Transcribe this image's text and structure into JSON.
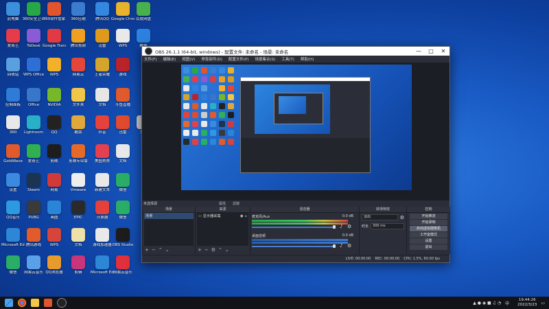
{
  "desktop": {
    "icons": [
      {
        "label": "此电脑",
        "color": "#3b8fdb"
      },
      {
        "label": "360安全卫士",
        "color": "#28a745"
      },
      {
        "label": "360软件管家",
        "color": "#e0542e"
      },
      {
        "label": "360压缩",
        "color": "#3a7cd0"
      },
      {
        "label": "腾讯QQ",
        "color": "#3488e0"
      },
      {
        "label": "Google Chrome",
        "color": "#e8b22d"
      },
      {
        "label": "百度网盘",
        "color": "#48b14d"
      },
      {
        "label": "爱奇艺",
        "color": "#e53b4b"
      },
      {
        "label": "ToDesk",
        "color": "#8a5bd6"
      },
      {
        "label": "Google Translate",
        "color": "#e23a43"
      },
      {
        "label": "腾讯视频",
        "color": "#f0a020"
      },
      {
        "label": "迅雷",
        "color": "#e09a1b"
      },
      {
        "label": "WPS",
        "color": "#e9e9e9"
      },
      {
        "label": "酷狗",
        "color": "#2c82e0"
      },
      {
        "label": "回收站",
        "color": "#5aa0e0"
      },
      {
        "label": "WPS Office",
        "color": "#2d6fd6"
      },
      {
        "label": "WPS",
        "color": "#f3b02b"
      },
      {
        "label": "网易云",
        "color": "#e5463a"
      },
      {
        "label": "王者荣耀",
        "color": "#d4a52c"
      },
      {
        "label": "游戏",
        "color": "#b8242a"
      },
      {
        "label": "控制面板",
        "color": "#2f7bd8"
      },
      {
        "label": "Office",
        "color": "#3776c8"
      },
      {
        "label": "NVIDIA",
        "color": "#76b82a"
      },
      {
        "label": "文件夹",
        "color": "#f2c648"
      },
      {
        "label": "文档",
        "color": "#e6e6e6"
      },
      {
        "label": "斗鱼直播",
        "color": "#e05a2b"
      },
      {
        "label": "360",
        "color": "#e8e8e8"
      },
      {
        "label": "Lightroom",
        "color": "#28b0c8"
      },
      {
        "label": "QQ",
        "color": "#222"
      },
      {
        "label": "酷我",
        "color": "#e0a83b"
      },
      {
        "label": "抖音",
        "color": "#e5423b"
      },
      {
        "label": "迅雷",
        "color": "#e04a2e"
      },
      {
        "label": "文件",
        "color": "#ccc"
      },
      {
        "label": "GoldWave",
        "color": "#e05a2b"
      },
      {
        "label": "爱奇艺",
        "color": "#30b050"
      },
      {
        "label": "剪映",
        "color": "#1d1d1d"
      },
      {
        "label": "剪映专业版",
        "color": "#e56a2a"
      },
      {
        "label": "美图秀秀",
        "color": "#e5404f"
      },
      {
        "label": "文档",
        "color": "#e8e8e8"
      },
      {
        "label": "设置",
        "color": "#3c8ae0"
      },
      {
        "label": "Steam",
        "color": "#1b3550"
      },
      {
        "label": "网易",
        "color": "#d23a3a"
      },
      {
        "label": "Vmware",
        "color": "#eeeeee"
      },
      {
        "label": "新建文本",
        "color": "#e8e8e8"
      },
      {
        "label": "微信",
        "color": "#2aae67"
      },
      {
        "label": "QQ音乐",
        "color": "#2c9ae0"
      },
      {
        "label": "PUBG",
        "color": "#3a3a3a"
      },
      {
        "label": "画图",
        "color": "#2a84d8"
      },
      {
        "label": "EPIC",
        "color": "#2a2a2a"
      },
      {
        "label": "计算器",
        "color": "#e5403b"
      },
      {
        "label": "微信",
        "color": "#2aae67"
      },
      {
        "label": "Microsoft Edge",
        "color": "#2d86d6"
      },
      {
        "label": "腾讯游戏",
        "color": "#e25b2b"
      },
      {
        "label": "WPS",
        "color": "#d6453b"
      },
      {
        "label": "文档",
        "color": "#ede0a8"
      },
      {
        "label": "游戏加速器",
        "color": "#e9e9e9"
      },
      {
        "label": "OBS Studio",
        "color": "#1c1c1c"
      },
      {
        "label": "微信",
        "color": "#2aae67"
      },
      {
        "label": "网易云音乐",
        "color": "#5aa0e8"
      },
      {
        "label": "QQ浏览器",
        "color": "#e89b2d"
      },
      {
        "label": "剪辑",
        "color": "#c8357a"
      },
      {
        "label": "Microsoft Edge",
        "color": "#2d86d6"
      },
      {
        "label": "网易云音乐",
        "color": "#e0303b"
      }
    ]
  },
  "obs": {
    "title": "OBS 26.1.1 (64-bit, windows) - 配置文件: 未命名 - 场景: 未命名",
    "menu": [
      "文件(F)",
      "编辑(E)",
      "视图(V)",
      "停靠部件(D)",
      "配置文件(P)",
      "场景集合(S)",
      "工具(T)",
      "帮助(H)"
    ],
    "dock_header": {
      "left": "未选择源",
      "tab1": "属性",
      "tab2": "滤镜"
    },
    "scenes": {
      "title": "场景",
      "items": [
        "场景"
      ]
    },
    "sources": {
      "title": "来源",
      "items": [
        "显示器采集"
      ]
    },
    "mixer": {
      "title": "混音器",
      "tracks": [
        {
          "name": "麦克风/Aux",
          "db": "0.0 dB"
        },
        {
          "name": "桌面音频",
          "db": "0.0 dB"
        }
      ]
    },
    "transitions": {
      "title": "转场特效",
      "type": "淡出",
      "duration_label": "时长",
      "duration": "300 ms"
    },
    "controls": {
      "title": "控制",
      "buttons": [
        "开始推流",
        "开始录制",
        "启动虚拟摄像机",
        "工作室模式",
        "设置",
        "退出"
      ]
    },
    "status": {
      "live": "LIVE: 00:00:00",
      "rec": "REC: 00:00:00",
      "cpu": "CPU: 1.5%, 60.00 fps"
    }
  },
  "taskbar": {
    "time": "19:44:26",
    "date": "2022/3/23",
    "lang": "中"
  }
}
